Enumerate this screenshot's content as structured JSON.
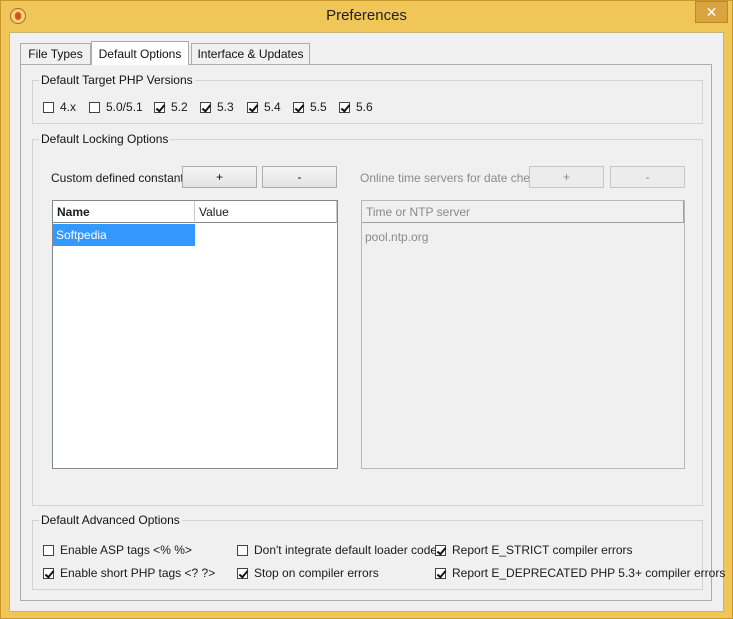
{
  "window": {
    "title": "Preferences",
    "close_glyph": "✕"
  },
  "tabs": [
    {
      "label": "File Types",
      "active": false
    },
    {
      "label": "Default Options",
      "active": true
    },
    {
      "label": "Interface & Updates",
      "active": false
    }
  ],
  "php_versions": {
    "label": "Default Target PHP Versions",
    "items": [
      {
        "label": "4.x",
        "checked": false
      },
      {
        "label": "5.0/5.1",
        "checked": false
      },
      {
        "label": "5.2",
        "checked": true
      },
      {
        "label": "5.3",
        "checked": true
      },
      {
        "label": "5.4",
        "checked": true
      },
      {
        "label": "5.5",
        "checked": true
      },
      {
        "label": "5.6",
        "checked": true
      }
    ]
  },
  "locking": {
    "label": "Default Locking Options",
    "constants": {
      "label": "Custom defined constants",
      "add_label": "+",
      "remove_label": "-",
      "columns": [
        "Name",
        "Value"
      ],
      "rows": [
        {
          "name": "Softpedia",
          "value": "",
          "selected": true
        }
      ]
    },
    "time_servers": {
      "label": "Online time servers for date check",
      "add_label": "+",
      "remove_label": "-",
      "enabled": false,
      "column": "Time or NTP server",
      "rows": [
        "pool.ntp.org"
      ]
    }
  },
  "advanced": {
    "label": "Default Advanced Options",
    "items": [
      {
        "label": "Enable ASP tags <% %>",
        "checked": false
      },
      {
        "label": "Don't integrate default loader code",
        "checked": false
      },
      {
        "label": "Report E_STRICT compiler errors",
        "checked": true
      },
      {
        "label": "Enable short PHP tags <? ?>",
        "checked": true
      },
      {
        "label": "Stop on compiler errors",
        "checked": true
      },
      {
        "label": "Report E_DEPRECATED PHP 5.3+ compiler errors",
        "checked": true
      }
    ]
  }
}
